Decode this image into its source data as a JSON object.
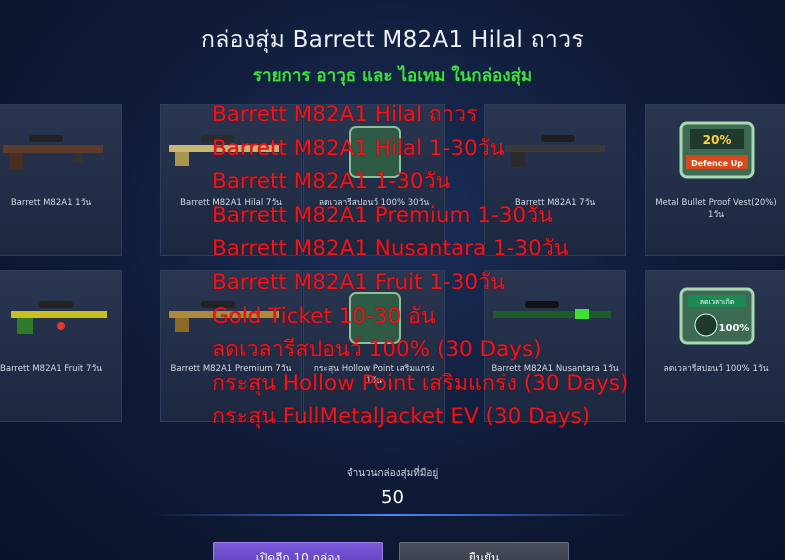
{
  "header": {
    "title": "กล่องสุ่ม Barrett M82A1 Hilal ถาวร",
    "subtitle": "รายการ อาวุธ และ ไอเทม ในกล่องสุ่ม"
  },
  "items": [
    {
      "label": "Barrett M82A1 1วัน",
      "icon": "sniper-rifle-brown-icon"
    },
    {
      "label": "Barrett M82A1 Hilal 7วัน",
      "icon": "sniper-rifle-gold-icon"
    },
    {
      "label": "ลดเวลารีสปอนว์ 100% 30วัน",
      "icon": "respawn-item-icon"
    },
    {
      "label": "Barrett M82A1 7วัน",
      "icon": "sniper-rifle-icon"
    },
    {
      "label": "Metal Bullet Proof Vest(20%) 1วัน",
      "icon": "defence-up-vest-icon",
      "badge": "20%",
      "badge_sub": "Defence Up"
    },
    {
      "label": "Barrett M82A1 Fruit 7วัน",
      "icon": "sniper-rifle-fruit-icon"
    },
    {
      "label": "Barrett M82A1 Premium 7วัน",
      "icon": "sniper-rifle-premium-icon"
    },
    {
      "label": "กระสุน Hollow Point เสริมแกร่ง 1วัน",
      "icon": "hollow-point-ammo-icon"
    },
    {
      "label": "Barrett M82A1 Nusantara 1วัน",
      "icon": "sniper-rifle-nusantara-icon"
    },
    {
      "label": "ลดเวลารีสปอนว์ 100% 1วัน",
      "icon": "respawn-timer-icon",
      "badge": "ลดเวลาเกิด",
      "badge_sub": "100%"
    }
  ],
  "overlay_lines": [
    "Barrett M82A1 Hilal ถาวร",
    "Barrett M82A1 Hilal 1-30วัน",
    "Barrett M82A1 1-30วัน",
    "Barrett M82A1 Premium 1-30วัน",
    "Barrett M82A1 Nusantara 1-30วัน",
    "Barrett M82A1 Fruit 1-30วัน",
    "Gold Ticket 10-30 อัน",
    "ลดเวลารีสปอนว์ 100% (30 Days)",
    "กระสุน Hollow Point เสริมแกร่ง (30 Days)",
    "กระสุน FullMetalJacket EV (30 Days)"
  ],
  "footer": {
    "count_label": "จำนวนกล่องสุ่มที่มีอยู่",
    "count_value": "50",
    "open_button": "เปิดอีก 10 กล่อง",
    "cancel_button": "ยืนยัน"
  },
  "colors": {
    "overlay_text": "#f2141b",
    "subtitle": "#3ee13a",
    "open_button": "#6a4ac8"
  }
}
